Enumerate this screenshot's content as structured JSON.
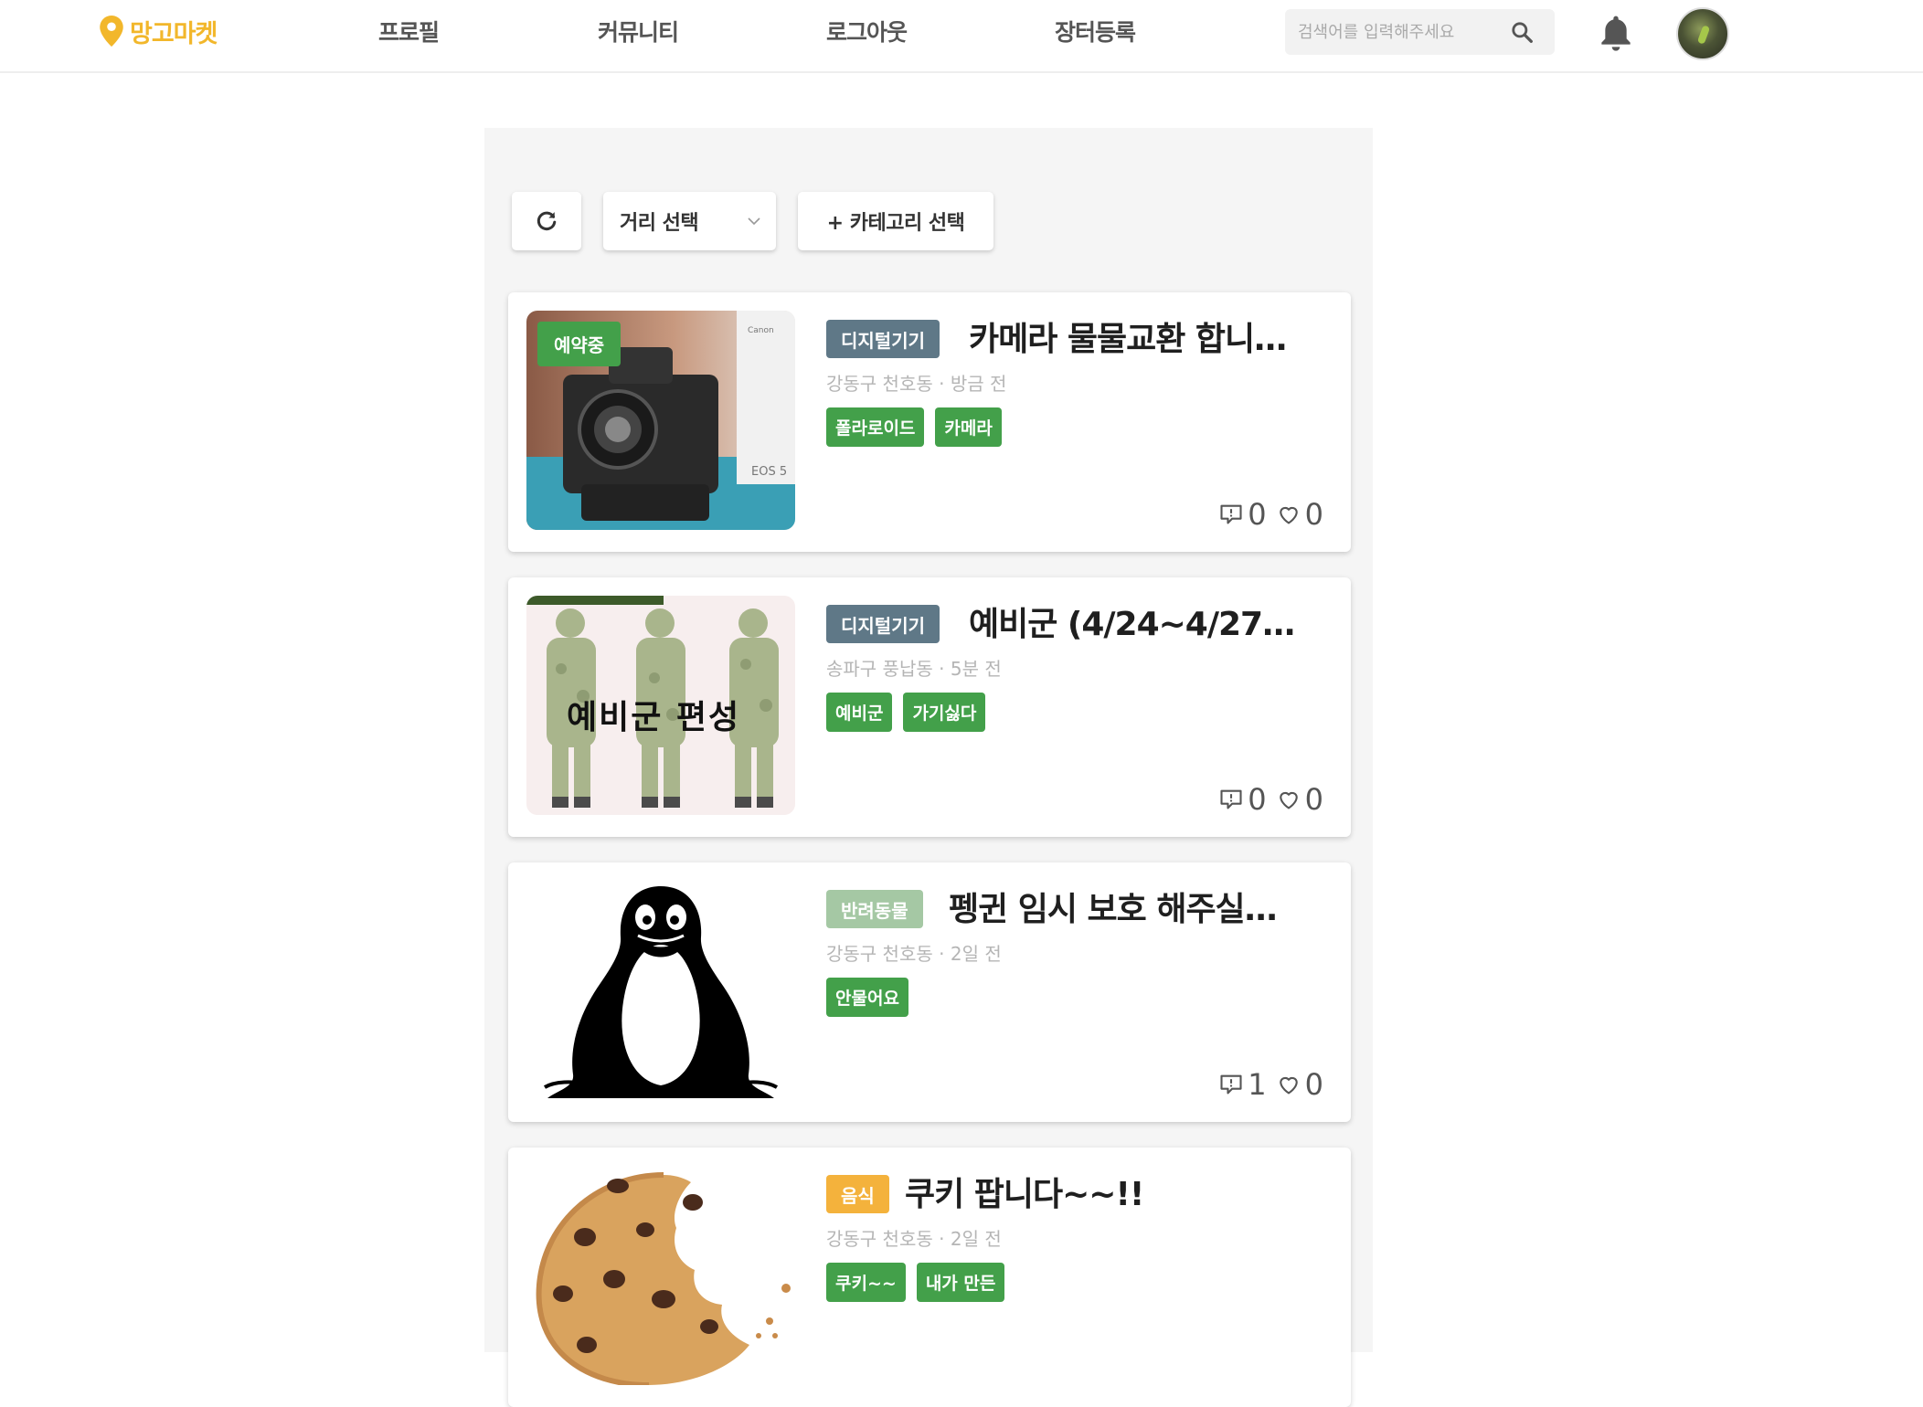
{
  "header": {
    "logo_text": "망고마켓",
    "nav": [
      "프로필",
      "커뮤니티",
      "로그아웃",
      "장터등록"
    ],
    "search_placeholder": "검색어를 입력해주세요"
  },
  "toolbar": {
    "distance_label": "거리 선택",
    "category_label": "+ 카테고리 선택"
  },
  "colors": {
    "brand": "#f2b72b",
    "tag_green": "#43a04a",
    "category_digital": "#5f7887",
    "category_pet": "#a5c8a4",
    "category_food": "#f4b23c"
  },
  "posts": [
    {
      "status": "예약중",
      "category": "디지털기기",
      "title": "카메라 물물교환 합니…",
      "location": "강동구 천호동",
      "time": "방금 전",
      "tags": [
        "폴라로이드",
        "카메라"
      ],
      "comments": "0",
      "likes": "0",
      "image": "camera"
    },
    {
      "status": "",
      "category": "디지털기기",
      "title": "예비군 (4/24~4/27…",
      "location": "송파구 풍납동",
      "time": "5분 전",
      "tags": [
        "예비군",
        "가기싫다"
      ],
      "comments": "0",
      "likes": "0",
      "image": "soldiers",
      "image_text": "예비군 편성"
    },
    {
      "status": "",
      "category": "반려동물",
      "title": "펭귄 임시 보호 해주실…",
      "location": "강동구 천호동",
      "time": "2일 전",
      "tags": [
        "안물어요"
      ],
      "comments": "1",
      "likes": "0",
      "image": "penguin"
    },
    {
      "status": "",
      "category": "음식",
      "title": "쿠키 팝니다~~!!",
      "location": "강동구 천호동",
      "time": "2일 전",
      "tags": [
        "쿠키~~",
        "내가 만든"
      ],
      "comments": "",
      "likes": "",
      "image": "cookie"
    }
  ]
}
